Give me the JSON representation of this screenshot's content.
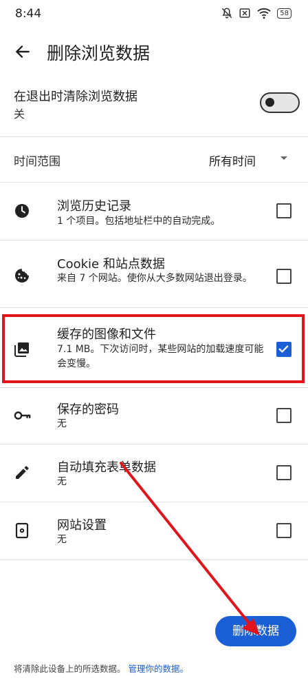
{
  "status_bar": {
    "time": "8:44",
    "battery": "58"
  },
  "app_bar": {
    "title": "删除浏览数据"
  },
  "clear_on_exit": {
    "label": "在退出时清除浏览数据",
    "value": "关",
    "enabled": false
  },
  "time_range": {
    "label": "时间范围",
    "value": "所有时间"
  },
  "items": [
    {
      "title": "浏览历史记录",
      "subtitle": "1 个项目。包括地址栏中的自动完成。",
      "icon": "clock-icon",
      "checked": false
    },
    {
      "title": "Cookie 和站点数据",
      "subtitle": "来自 7 个网站。使你从大多数网站退出登录。",
      "icon": "cookie-icon",
      "checked": false
    },
    {
      "title": "缓存的图像和文件",
      "subtitle": "7.1 MB。下次访问时，某些网站的加载速度可能会变慢。",
      "icon": "image-icon",
      "checked": true
    },
    {
      "title": "保存的密码",
      "subtitle": "无",
      "icon": "key-icon",
      "checked": false
    },
    {
      "title": "自动填充表单数据",
      "subtitle": "无",
      "icon": "pencil-icon",
      "checked": false
    },
    {
      "title": "网站设置",
      "subtitle": "无",
      "icon": "site-settings-icon",
      "checked": false
    }
  ],
  "delete_button": {
    "label": "删除数据"
  },
  "footer": {
    "text": "将清除此设备上的所选数据。",
    "link": "管理你的数据。"
  },
  "colors": {
    "accent": "#1a5fd6",
    "annotation": "#e0141a"
  }
}
